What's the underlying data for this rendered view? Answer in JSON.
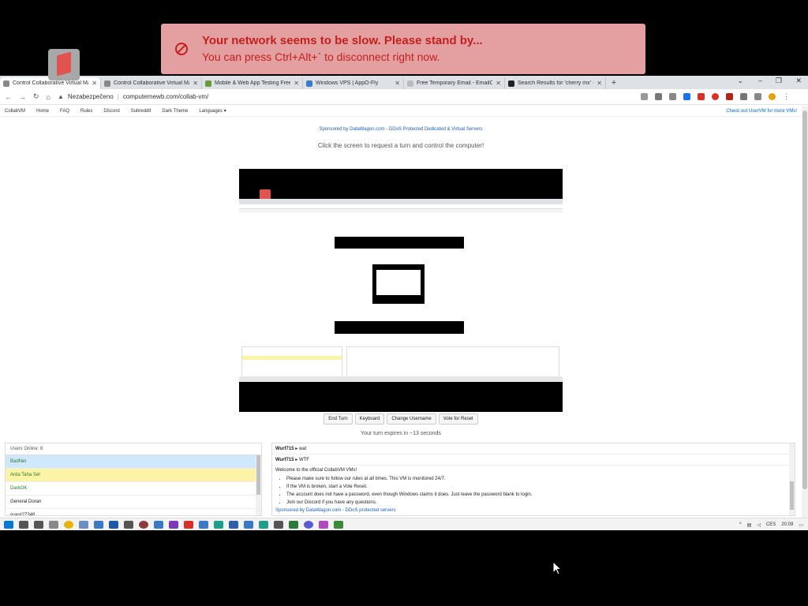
{
  "banner": {
    "title": "Your network seems to be slow. Please stand by...",
    "subtitle": "You can press Ctrl+Alt+` to disconnect right now."
  },
  "browser": {
    "tabs": [
      {
        "label": "Control Collaborative Virtual Ma",
        "active": true
      },
      {
        "label": "Control Collaborative Virtual Ma",
        "active": false
      },
      {
        "label": "Mobile & Web App Testing Free",
        "active": false
      },
      {
        "label": "Windows VPS | AppO-Fly",
        "active": false
      },
      {
        "label": "Free Temporary Email - EmailOnD",
        "active": false
      },
      {
        "label": "Search Results for 'cherry mx' - T",
        "active": false
      }
    ],
    "security_label": "Nezabezpečeno",
    "url": "computernewb.com/collab-vm/"
  },
  "site_nav": {
    "items": [
      "CollabVM",
      "Home",
      "FAQ",
      "Rules",
      "Discord",
      "Subreddit",
      "Dark Theme",
      "Languages ▾"
    ],
    "right_link": "Check out UserVM for more VMs!"
  },
  "page": {
    "sponsor": "Sponsored by DataWagon.com - DDoS Protected Dedicated & Virtual Servers",
    "click_message": "Click the screen to request a turn and control the computer!",
    "buttons": [
      "End Turn",
      "Keyboard",
      "Change Username",
      "Vote for Reset"
    ],
    "turn_message": "Your turn expires in ~13 seconds"
  },
  "users": {
    "header": "Users Online: 8",
    "list": [
      {
        "name": "BadNet",
        "bg": "#cfe8fb",
        "color": "#2a7a2a"
      },
      {
        "name": "Arda Taha Sel",
        "bg": "#fbf4a6",
        "color": "#2a7a2a"
      },
      {
        "name": "DarkOK",
        "bg": "#ffffff",
        "color": "#2a7a2a"
      },
      {
        "name": "General Doran",
        "bg": "#ffffff",
        "color": "#222222"
      },
      {
        "name": "guest27348",
        "bg": "#ffffff",
        "color": "#222222"
      }
    ]
  },
  "chat": {
    "messages": [
      {
        "user": "Wurf715",
        "text": "wat"
      },
      {
        "user": "Wurf715",
        "text": "WTF"
      }
    ],
    "welcome": "Welcome to the official CollabVM VMs!",
    "rules": [
      "Please make sure to follow our rules at all times. This VM is monitored 24/7.",
      "If the VM is broken, start a Vote Reset.",
      "The account does not have a password, even though Windows claims it does. Just leave the password blank to login.",
      "Join our Discord if you have any questions."
    ],
    "sponsor": "Sponsored by DataWagon.com - DDoS protected servers"
  },
  "taskbar": {
    "lang": "CES",
    "time": "20:09"
  },
  "colors": {
    "banner_bg": "#e4a0a0",
    "banner_text": "#c21f1f",
    "link": "#1a5fb4"
  }
}
